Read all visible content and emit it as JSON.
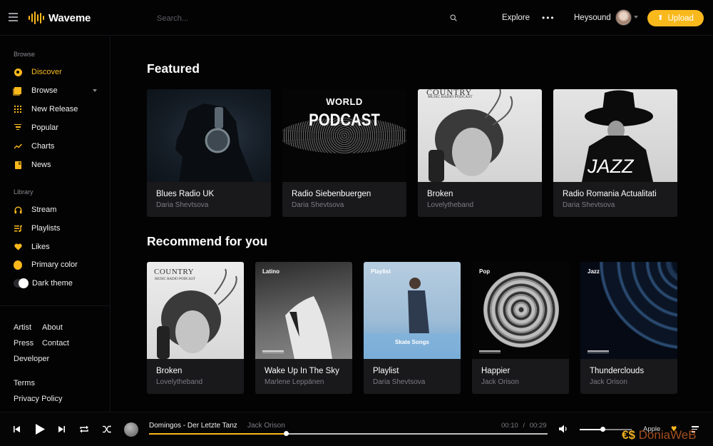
{
  "app": {
    "name": "Waveme"
  },
  "colors": {
    "accent": "#f9b91d",
    "background": "#030304",
    "card": "#19191c",
    "muted": "#7c7d83"
  },
  "header": {
    "search_placeholder": "Search...",
    "explore_label": "Explore",
    "more_label": "•••",
    "user_name": "Heysound",
    "upload_label": "Upload",
    "upload_icon": "⬆"
  },
  "sidebar": {
    "browse_heading": "Browse",
    "browse_items": [
      {
        "label": "Discover",
        "icon": "disc-icon",
        "active": true
      },
      {
        "label": "Browse",
        "icon": "browse-icon",
        "has_dropdown": true
      },
      {
        "label": "New Release",
        "icon": "grid-icon"
      },
      {
        "label": "Popular",
        "icon": "filter-icon"
      },
      {
        "label": "Charts",
        "icon": "trending-icon"
      },
      {
        "label": "News",
        "icon": "news-icon"
      }
    ],
    "library_heading": "Library",
    "library_items": [
      {
        "label": "Stream",
        "icon": "headphones-icon"
      },
      {
        "label": "Playlists",
        "icon": "playlist-icon"
      },
      {
        "label": "Likes",
        "icon": "heart-icon"
      },
      {
        "label": "Primary color",
        "icon": "color-dot-icon"
      },
      {
        "label": "Dark theme",
        "icon": "toggle",
        "toggle_on": true
      }
    ],
    "footer_links": {
      "artist": "Artist",
      "about": "About",
      "press": "Press",
      "contact": "Contact",
      "developer": "Developer",
      "terms": "Terms",
      "privacy": "Privacy Policy"
    }
  },
  "main": {
    "featured_title": "Featured",
    "featured": [
      {
        "title": "Blues Radio UK",
        "artist": "Daria Shevtsova",
        "cover_text": ""
      },
      {
        "title": "Radio Siebenbuergen",
        "artist": "Daria Shevtsova",
        "cover_text_top": "WORLD",
        "cover_text_main": "PODCAST"
      },
      {
        "title": "Broken",
        "artist": "Lovelytheband",
        "cover_text_top": "COUNTRY",
        "cover_text_main": "MUSIC RADIO PODCAST"
      },
      {
        "title": "Radio Romania Actualitati",
        "artist": "Daria Shevtsova",
        "cover_text_main": "JAZZ"
      }
    ],
    "recommend_title": "Recommend for you",
    "recommended": [
      {
        "title": "Broken",
        "artist": "Lovelytheband",
        "cover_label": "COUNTRY",
        "cover_sub": "MUSIC RADIO PODCAST"
      },
      {
        "title": "Wake Up In The Sky",
        "artist": "Marlene Leppänen",
        "cover_label": "Latino"
      },
      {
        "title": "Playlist",
        "artist": "Daria Shevtsova",
        "cover_label": "Playlist",
        "cover_caption": "Skate Songs"
      },
      {
        "title": "Happier",
        "artist": "Jack Orison",
        "cover_label": "Pop"
      },
      {
        "title": "Thunderclouds",
        "artist": "Jack Orison",
        "cover_label": "Jazz"
      }
    ]
  },
  "player": {
    "track_title": "Domingos - Der Letzte Tanz",
    "track_artist": "Jack Orison",
    "current_time": "00:10",
    "separator": "/",
    "duration": "00:29",
    "progress_percent": 34.5,
    "volume_percent": 45,
    "output_device": "Apple",
    "liked": true
  },
  "watermark": {
    "prefix": "€$",
    "text": "DoniaWeB"
  }
}
